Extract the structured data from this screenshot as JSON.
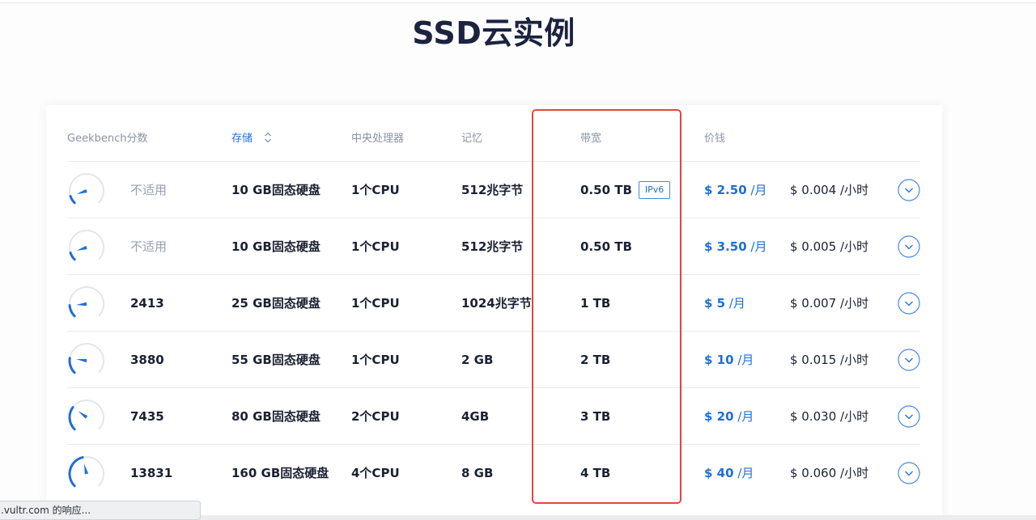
{
  "page": {
    "title": "SSD云实例"
  },
  "table": {
    "headers": {
      "geekbench": "Geekbench分数",
      "storage": "存储",
      "cpu": "中央处理器",
      "memory": "记忆",
      "bandwidth": "带宽",
      "price": "价钱"
    },
    "rows": [
      {
        "score": "不适用",
        "storage": "10 GB固态硬盘",
        "cpu": "1个CPU",
        "memory": "512兆字节",
        "bandwidth": "0.50 TB",
        "badge": "IPv6",
        "price": "$ 2.50",
        "price_unit": " /月",
        "hourly": "$ 0.004 /小时",
        "gauge_level": 0.1
      },
      {
        "score": "不适用",
        "storage": "10 GB固态硬盘",
        "cpu": "1个CPU",
        "memory": "512兆字节",
        "bandwidth": "0.50 TB",
        "price": "$ 3.50",
        "price_unit": " /月",
        "hourly": "$ 0.005 /小时",
        "gauge_level": 0.1
      },
      {
        "score": "2413",
        "storage": "25 GB固态硬盘",
        "cpu": "1个CPU",
        "memory": "1024兆字节",
        "bandwidth": "1 TB",
        "price": "$ 5",
        "price_unit": " /月",
        "hourly": "$ 0.007 /小时",
        "gauge_level": 0.15
      },
      {
        "score": "3880",
        "storage": "55 GB固态硬盘",
        "cpu": "1个CPU",
        "memory": "2 GB",
        "bandwidth": "2 TB",
        "price": "$ 10",
        "price_unit": " /月",
        "hourly": "$ 0.015 /小时",
        "gauge_level": 0.2
      },
      {
        "score": "7435",
        "storage": "80 GB固态硬盘",
        "cpu": "2个CPU",
        "memory": "4GB",
        "bandwidth": "3 TB",
        "price": "$ 20",
        "price_unit": " /月",
        "hourly": "$ 0.030 /小时",
        "gauge_level": 0.3
      },
      {
        "score": "13831",
        "storage": "160 GB固态硬盘",
        "cpu": "4个CPU",
        "memory": "8 GB",
        "bandwidth": "4 TB",
        "price": "$ 40",
        "price_unit": " /月",
        "hourly": "$ 0.060 /小时",
        "gauge_level": 0.45
      }
    ]
  },
  "status_bar": {
    "text": ".vultr.com 的响应..."
  },
  "colors": {
    "accent": "#1f6fd6",
    "highlight_border": "#e0473e",
    "title": "#1c2340"
  }
}
